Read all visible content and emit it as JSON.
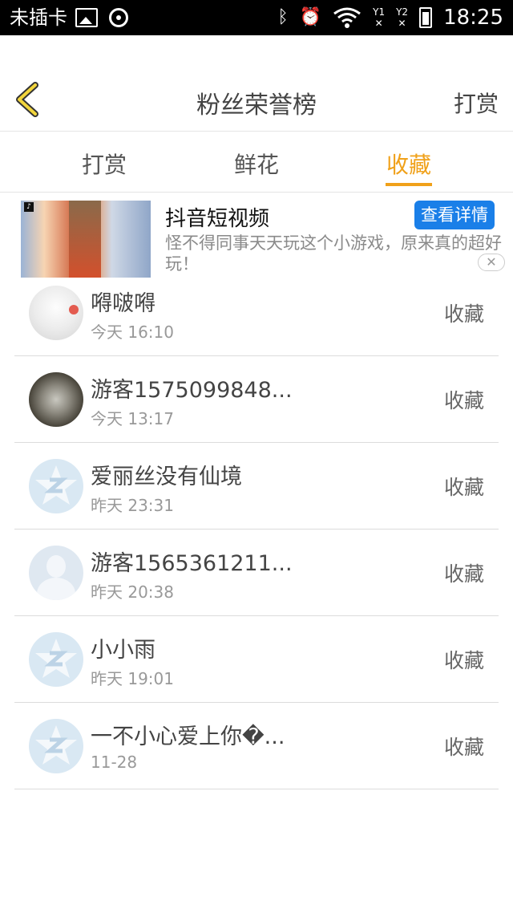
{
  "status_bar": {
    "carrier": "未插卡",
    "sim1": "Y1",
    "sim2": "Y2",
    "sim_x": "✕",
    "time": "18:25",
    "icons": [
      "image-icon",
      "disc-icon",
      "bluetooth-icon",
      "alarm-icon",
      "wifi-icon",
      "battery-icon"
    ]
  },
  "header": {
    "title": "粉丝荣誉榜",
    "right_action": "打赏",
    "back_icon": "chevron-left-icon",
    "accent_color": "#f0a11a"
  },
  "tabs": [
    {
      "label": "打赏",
      "active": false
    },
    {
      "label": "鲜花",
      "active": false
    },
    {
      "label": "收藏",
      "active": true
    }
  ],
  "ad": {
    "title": "抖音短视频",
    "button": "查看详情",
    "description": "怪不得同事天天玩这个小游戏，原来真的超好玩！",
    "close_icon": "close-icon",
    "button_color": "#1a7fe8"
  },
  "list": [
    {
      "name": "嘚啵嘚",
      "time": "今天 16:10",
      "action": "收藏",
      "avatar": "anime"
    },
    {
      "name": "游客1575099848...",
      "time": "今天 13:17",
      "action": "收藏",
      "avatar": "photo"
    },
    {
      "name": "爱丽丝没有仙境",
      "time": "昨天 23:31",
      "action": "收藏",
      "avatar": "qq-default"
    },
    {
      "name": "游客1565361211...",
      "time": "昨天 20:38",
      "action": "收藏",
      "avatar": "person-default"
    },
    {
      "name": "小小雨",
      "time": "昨天 19:01",
      "action": "收藏",
      "avatar": "qq-default"
    },
    {
      "name": "一不小心爱上你�...",
      "time": "11-28",
      "action": "收藏",
      "avatar": "qq-default"
    }
  ]
}
